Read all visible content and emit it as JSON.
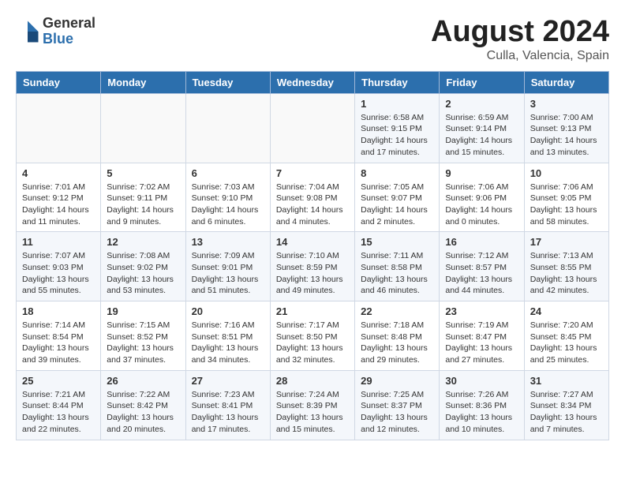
{
  "header": {
    "logo_general": "General",
    "logo_blue": "Blue",
    "title": "August 2024",
    "location": "Culla, Valencia, Spain"
  },
  "days_of_week": [
    "Sunday",
    "Monday",
    "Tuesday",
    "Wednesday",
    "Thursday",
    "Friday",
    "Saturday"
  ],
  "weeks": [
    [
      {
        "day": "",
        "info": ""
      },
      {
        "day": "",
        "info": ""
      },
      {
        "day": "",
        "info": ""
      },
      {
        "day": "",
        "info": ""
      },
      {
        "day": "1",
        "info": "Sunrise: 6:58 AM\nSunset: 9:15 PM\nDaylight: 14 hours\nand 17 minutes."
      },
      {
        "day": "2",
        "info": "Sunrise: 6:59 AM\nSunset: 9:14 PM\nDaylight: 14 hours\nand 15 minutes."
      },
      {
        "day": "3",
        "info": "Sunrise: 7:00 AM\nSunset: 9:13 PM\nDaylight: 14 hours\nand 13 minutes."
      }
    ],
    [
      {
        "day": "4",
        "info": "Sunrise: 7:01 AM\nSunset: 9:12 PM\nDaylight: 14 hours\nand 11 minutes."
      },
      {
        "day": "5",
        "info": "Sunrise: 7:02 AM\nSunset: 9:11 PM\nDaylight: 14 hours\nand 9 minutes."
      },
      {
        "day": "6",
        "info": "Sunrise: 7:03 AM\nSunset: 9:10 PM\nDaylight: 14 hours\nand 6 minutes."
      },
      {
        "day": "7",
        "info": "Sunrise: 7:04 AM\nSunset: 9:08 PM\nDaylight: 14 hours\nand 4 minutes."
      },
      {
        "day": "8",
        "info": "Sunrise: 7:05 AM\nSunset: 9:07 PM\nDaylight: 14 hours\nand 2 minutes."
      },
      {
        "day": "9",
        "info": "Sunrise: 7:06 AM\nSunset: 9:06 PM\nDaylight: 14 hours\nand 0 minutes."
      },
      {
        "day": "10",
        "info": "Sunrise: 7:06 AM\nSunset: 9:05 PM\nDaylight: 13 hours\nand 58 minutes."
      }
    ],
    [
      {
        "day": "11",
        "info": "Sunrise: 7:07 AM\nSunset: 9:03 PM\nDaylight: 13 hours\nand 55 minutes."
      },
      {
        "day": "12",
        "info": "Sunrise: 7:08 AM\nSunset: 9:02 PM\nDaylight: 13 hours\nand 53 minutes."
      },
      {
        "day": "13",
        "info": "Sunrise: 7:09 AM\nSunset: 9:01 PM\nDaylight: 13 hours\nand 51 minutes."
      },
      {
        "day": "14",
        "info": "Sunrise: 7:10 AM\nSunset: 8:59 PM\nDaylight: 13 hours\nand 49 minutes."
      },
      {
        "day": "15",
        "info": "Sunrise: 7:11 AM\nSunset: 8:58 PM\nDaylight: 13 hours\nand 46 minutes."
      },
      {
        "day": "16",
        "info": "Sunrise: 7:12 AM\nSunset: 8:57 PM\nDaylight: 13 hours\nand 44 minutes."
      },
      {
        "day": "17",
        "info": "Sunrise: 7:13 AM\nSunset: 8:55 PM\nDaylight: 13 hours\nand 42 minutes."
      }
    ],
    [
      {
        "day": "18",
        "info": "Sunrise: 7:14 AM\nSunset: 8:54 PM\nDaylight: 13 hours\nand 39 minutes."
      },
      {
        "day": "19",
        "info": "Sunrise: 7:15 AM\nSunset: 8:52 PM\nDaylight: 13 hours\nand 37 minutes."
      },
      {
        "day": "20",
        "info": "Sunrise: 7:16 AM\nSunset: 8:51 PM\nDaylight: 13 hours\nand 34 minutes."
      },
      {
        "day": "21",
        "info": "Sunrise: 7:17 AM\nSunset: 8:50 PM\nDaylight: 13 hours\nand 32 minutes."
      },
      {
        "day": "22",
        "info": "Sunrise: 7:18 AM\nSunset: 8:48 PM\nDaylight: 13 hours\nand 29 minutes."
      },
      {
        "day": "23",
        "info": "Sunrise: 7:19 AM\nSunset: 8:47 PM\nDaylight: 13 hours\nand 27 minutes."
      },
      {
        "day": "24",
        "info": "Sunrise: 7:20 AM\nSunset: 8:45 PM\nDaylight: 13 hours\nand 25 minutes."
      }
    ],
    [
      {
        "day": "25",
        "info": "Sunrise: 7:21 AM\nSunset: 8:44 PM\nDaylight: 13 hours\nand 22 minutes."
      },
      {
        "day": "26",
        "info": "Sunrise: 7:22 AM\nSunset: 8:42 PM\nDaylight: 13 hours\nand 20 minutes."
      },
      {
        "day": "27",
        "info": "Sunrise: 7:23 AM\nSunset: 8:41 PM\nDaylight: 13 hours\nand 17 minutes."
      },
      {
        "day": "28",
        "info": "Sunrise: 7:24 AM\nSunset: 8:39 PM\nDaylight: 13 hours\nand 15 minutes."
      },
      {
        "day": "29",
        "info": "Sunrise: 7:25 AM\nSunset: 8:37 PM\nDaylight: 13 hours\nand 12 minutes."
      },
      {
        "day": "30",
        "info": "Sunrise: 7:26 AM\nSunset: 8:36 PM\nDaylight: 13 hours\nand 10 minutes."
      },
      {
        "day": "31",
        "info": "Sunrise: 7:27 AM\nSunset: 8:34 PM\nDaylight: 13 hours\nand 7 minutes."
      }
    ]
  ]
}
